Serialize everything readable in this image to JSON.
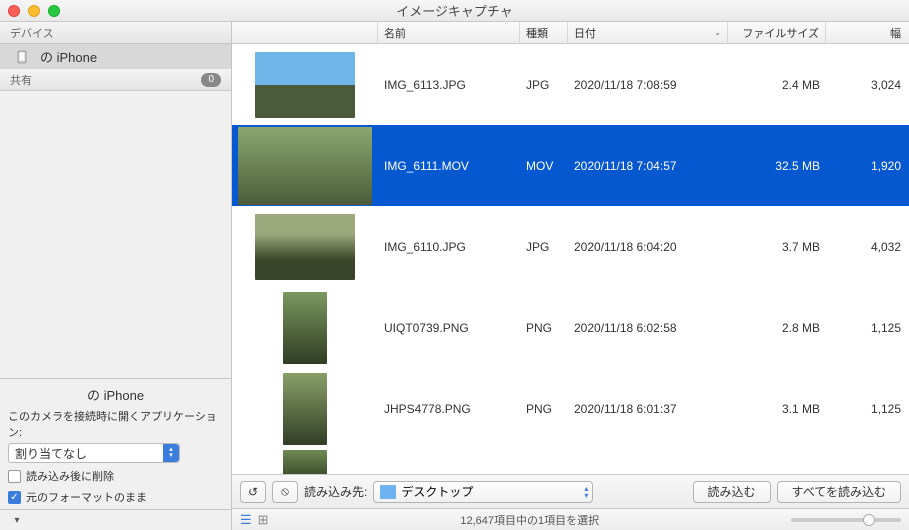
{
  "window": {
    "title": "イメージキャプチャ"
  },
  "sidebar": {
    "section_devices": "デバイス",
    "section_shared": "共有",
    "shared_count": "0",
    "device_name": "の iPhone",
    "bottom": {
      "device_label": "の iPhone",
      "open_with_label": "このカメラを接続時に開くアプリケーション:",
      "app_select_value": "割り当てなし",
      "delete_after_label": "読み込み後に削除",
      "keep_format_label": "元のフォーマットのまま"
    }
  },
  "columns": {
    "name": "名前",
    "kind": "種類",
    "date": "日付",
    "size": "ファイルサイズ",
    "width": "幅"
  },
  "rows": [
    {
      "name": "IMG_6113.JPG",
      "kind": "JPG",
      "date": "2020/11/18 7:08:59",
      "size": "2.4 MB",
      "width": "3,024",
      "shape": "land",
      "thumb": "t0",
      "selected": false
    },
    {
      "name": "IMG_6111.MOV",
      "kind": "MOV",
      "date": "2020/11/18 7:04:57",
      "size": "32.5 MB",
      "width": "1,920",
      "shape": "wide",
      "thumb": "t1",
      "selected": true
    },
    {
      "name": "IMG_6110.JPG",
      "kind": "JPG",
      "date": "2020/11/18 6:04:20",
      "size": "3.7 MB",
      "width": "4,032",
      "shape": "land",
      "thumb": "t2",
      "selected": false
    },
    {
      "name": "UIQT0739.PNG",
      "kind": "PNG",
      "date": "2020/11/18 6:02:58",
      "size": "2.8 MB",
      "width": "1,125",
      "shape": "port",
      "thumb": "t3",
      "selected": false
    },
    {
      "name": "JHPS4778.PNG",
      "kind": "PNG",
      "date": "2020/11/18 6:01:37",
      "size": "3.1 MB",
      "width": "1,125",
      "shape": "port",
      "thumb": "t4",
      "selected": false
    }
  ],
  "partial_row": {
    "shape": "port",
    "thumb": "t5"
  },
  "toolbar": {
    "rotate_icon": "↺",
    "delete_icon": "⦸",
    "dest_label": "読み込み先:",
    "dest_value": "デスクトップ",
    "import_label": "読み込む",
    "import_all_label": "すべてを読み込む"
  },
  "status": {
    "text": "12,647項目中の1項目を選択"
  }
}
